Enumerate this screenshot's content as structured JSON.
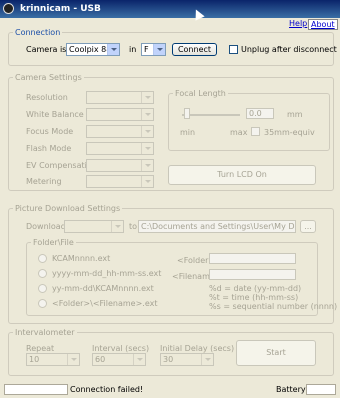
{
  "window": {
    "title": "krinnicam - USB"
  },
  "menu": {
    "help": "Help",
    "about": "About"
  },
  "connection": {
    "legend": "Connection",
    "camera_label": "Camera is a",
    "camera_value": "Coolpix 885",
    "in_label": "in",
    "drive_value": "F",
    "connect_label": "Connect",
    "unplug_label": "Unplug after disconnect"
  },
  "camera_settings": {
    "legend": "Camera Settings",
    "resolution": "Resolution",
    "white_balance": "White Balance",
    "focus_mode": "Focus Mode",
    "flash_mode": "Flash Mode",
    "ev_comp": "EV Compensation",
    "metering": "Metering",
    "focal_legend": "Focal Length",
    "focal_value": "0.0",
    "mm": "mm",
    "min": "min",
    "max": "max",
    "equiv": "35mm-equiv",
    "lcd_button": "Turn LCD On"
  },
  "download": {
    "legend": "Picture Download Settings",
    "download_label": "Download",
    "to_label": "to",
    "path": "C:\\Documents and Settings\\User\\My Documents",
    "browse": "...",
    "folder_legend": "Folder\\File",
    "opt1": "KCAMnnnn.ext",
    "opt2": "yyyy-mm-dd_hh-mm-ss.ext",
    "opt3": "yy-mm-dd\\KCAMnnnn.ext",
    "opt4": "<Folder>\\<Filename>.ext",
    "folder_label": "<Folder>",
    "filename_label": "<Filename>",
    "help1": "%d = date (yy-mm-dd)",
    "help2": "%t = time (hh-mm-ss)",
    "help3": "%s = sequential number (nnnn)"
  },
  "interval": {
    "legend": "Intervalometer",
    "repeat_label": "Repeat",
    "repeat_value": "10",
    "interval_label": "Interval (secs)",
    "interval_value": "60",
    "delay_label": "Initial Delay (secs)",
    "delay_value": "30",
    "start": "Start"
  },
  "status": {
    "message": "Connection failed!",
    "battery": "Battery"
  }
}
